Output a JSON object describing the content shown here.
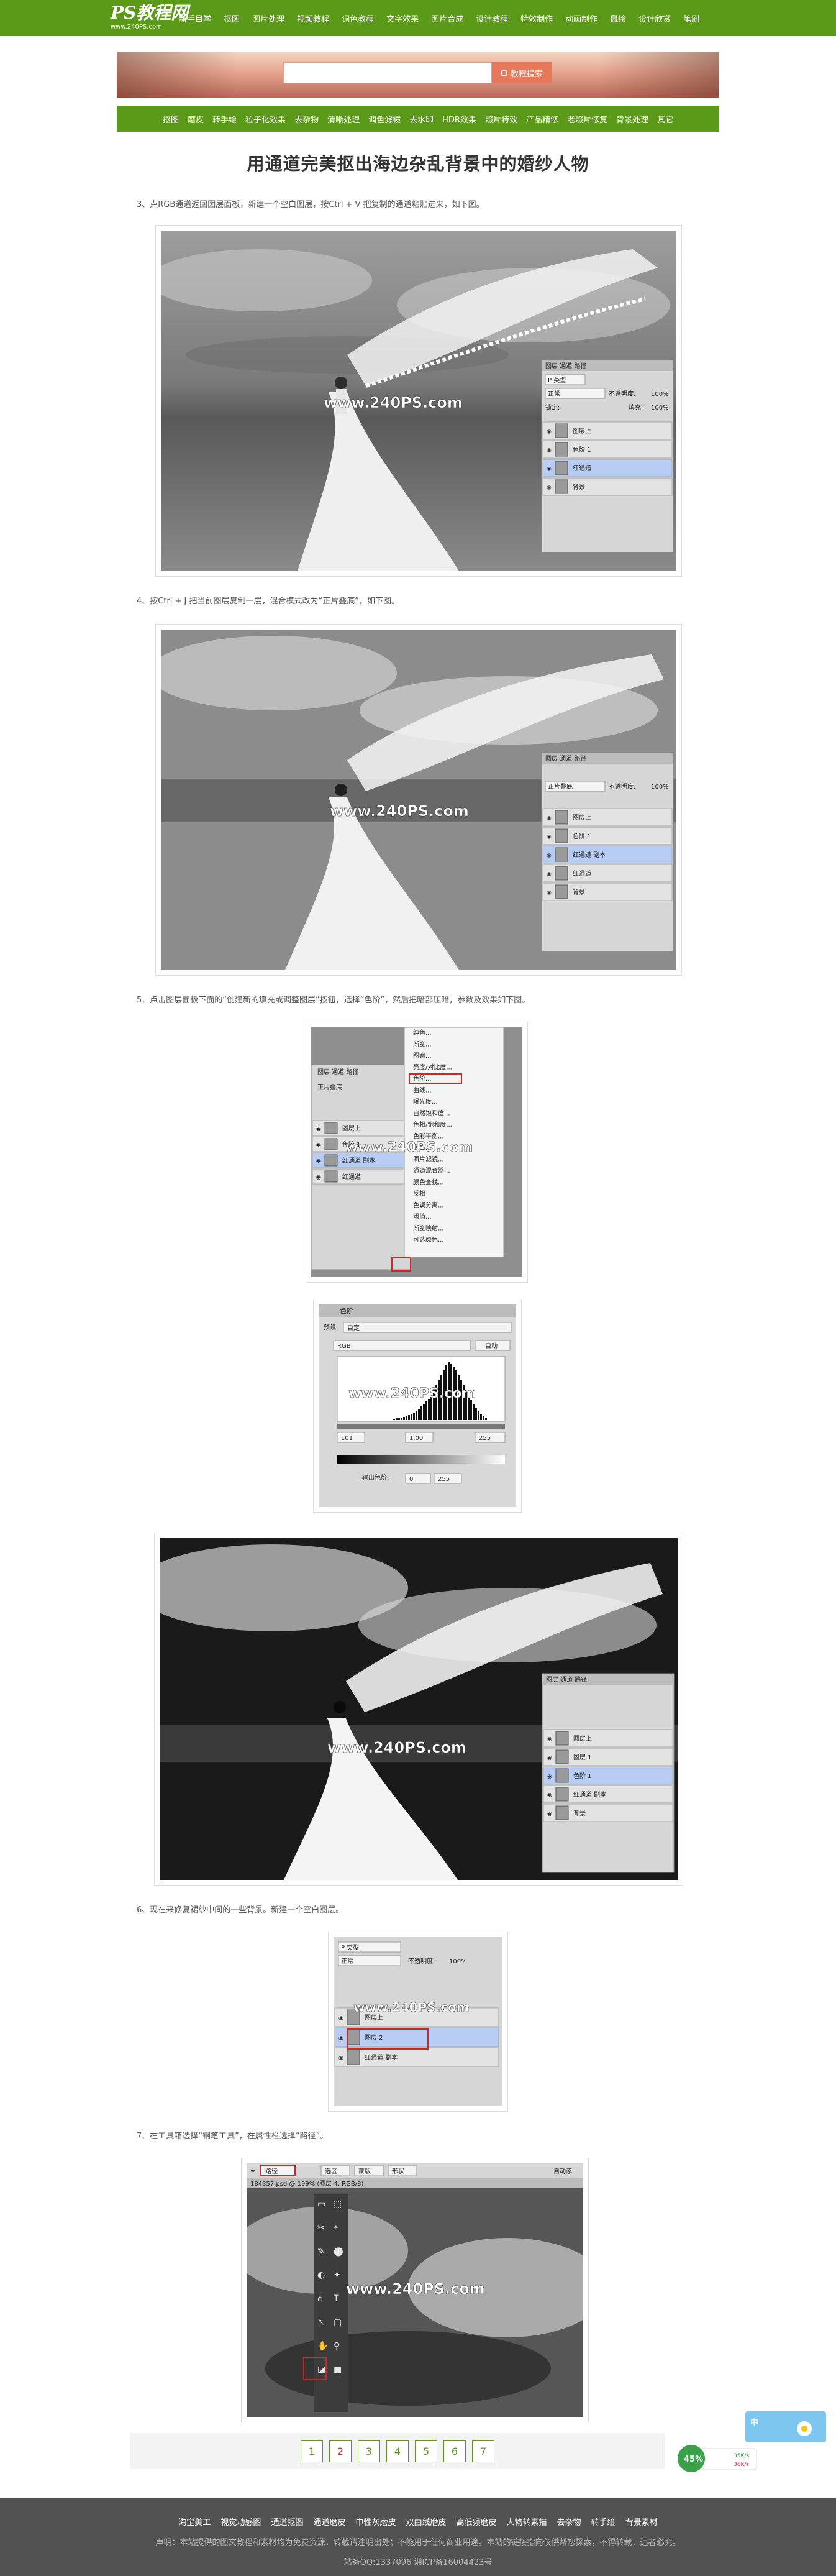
{
  "site": {
    "logo_text": "PS教程网",
    "logo_url": "www.240PS.com",
    "top_nav": [
      "新手目学",
      "抠图",
      "图片处理",
      "视频教程",
      "调色教程",
      "文字效果",
      "图片合成",
      "设计教程",
      "特效制作",
      "动画制作",
      "鼠绘",
      "设计欣赏",
      "笔刷"
    ],
    "search_placeholder": "",
    "search_button": "教程搜索",
    "sub_nav": [
      "抠图",
      "磨皮",
      "转手绘",
      "粒子化效果",
      "去杂物",
      "清晰处理",
      "调色滤镜",
      "去水印",
      "HDR效果",
      "照片特效",
      "产品精修",
      "老照片修复",
      "背景处理",
      "其它"
    ]
  },
  "article": {
    "title": "用通道完美抠出海边杂乱背景中的婚纱人物",
    "steps": [
      "3、点RGB通道返回图层面板，新建一个空白图层，按Ctrl + V 把复制的通道粘贴进来，如下图。",
      "4、按Ctrl + J 把当前图层复制一层，混合模式改为“正片叠底”，如下图。",
      "5、点击图层面板下面的“创建新的填充或调整图层”按钮，选择“色阶”，然后把暗部压暗，参数及效果如下图。",
      "6、现在来修复裙纱中间的一些背景。新建一个空白图层。",
      "7、在工具箱选择“钢笔工具”，在属性栏选择“路径”。"
    ],
    "watermark": "www.240PS.com"
  },
  "layers_panel": {
    "tabs": [
      "图层",
      "通道",
      "路径"
    ],
    "kind_select": "P 类型",
    "blend_normal": "正常",
    "blend_multiply": "正片叠底",
    "opacity_label": "不透明度:",
    "opacity_value": "100%",
    "fill_label": "填充:",
    "fill_value": "100%",
    "lock_label": "锁定:",
    "layers_step3": [
      "图层上",
      "色阶 1",
      "红通道",
      "背景"
    ],
    "layers_step4": [
      "图层上",
      "色阶 1",
      "红通道 副本",
      "红通道",
      "背景"
    ],
    "layers_step5b": [
      "图层上",
      "图层 1",
      "色阶 1",
      "红通道 副本",
      "背景"
    ],
    "layers_step6": [
      "图层上",
      "图层 2",
      "红通道 副本"
    ],
    "adjust_menu": [
      "纯色...",
      "渐变...",
      "图案...",
      "亮度/对比度...",
      "色阶...",
      "曲线...",
      "曝光度...",
      "自然饱和度...",
      "色相/饱和度...",
      "色彩平衡...",
      "黑白...",
      "照片滤镜...",
      "通道混合器...",
      "颜色查找...",
      "反相",
      "色调分离...",
      "阈值...",
      "渐变映射...",
      "可选颜色..."
    ],
    "adjust_highlight": "色阶..."
  },
  "levels_panel": {
    "title": "色阶",
    "preset_label": "预设:",
    "preset_value": "自定",
    "channel": "RGB",
    "auto_button": "自动",
    "input_black": "101",
    "input_gray": "1.00",
    "input_white": "255",
    "output_label": "输出色阶:",
    "output_black": "0",
    "output_white": "255"
  },
  "pen_tool": {
    "mode": "路径",
    "buttons": [
      "选区...",
      "蒙版",
      "形状"
    ],
    "align_label": "自动添",
    "doc_title": "184357.psd @ 199% (图层 4, RGB/8)"
  },
  "pagination": [
    "1",
    "2",
    "3",
    "4",
    "5",
    "6",
    "7"
  ],
  "pagination_current": "2",
  "gadget": {
    "percent": "45%",
    "up": "35K/s",
    "down": "36K/s"
  },
  "footer": {
    "links": [
      "淘宝美工",
      "视觉动感图",
      "通道抠图",
      "通道磨皮",
      "中性灰磨皮",
      "双曲线磨皮",
      "高低频磨皮",
      "人物转素描",
      "去杂物",
      "转手绘",
      "背景素材"
    ],
    "note": "声明：本站提供的图文教程和素材均为免费资源，转载请注明出处；不能用于任何商业用途。本站的链接指向仅供帮您探索，不得转载，违者必究。",
    "icp": "站务QQ:1337096 湘ICP备16004423号"
  },
  "colors": {
    "brand_green": "#5b9a18",
    "search_orange": "#e9785a",
    "page_red": "#e03232"
  }
}
